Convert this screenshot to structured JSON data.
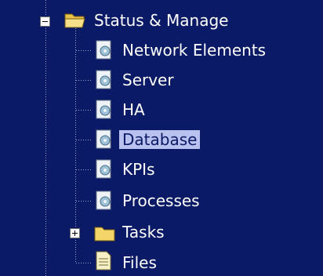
{
  "tree": {
    "root": {
      "label": "Status & Manage",
      "expanded": true,
      "children": [
        {
          "label": "Network Elements",
          "icon": "page-gear-icon"
        },
        {
          "label": "Server",
          "icon": "page-gear-icon"
        },
        {
          "label": "HA",
          "icon": "page-gear-icon"
        },
        {
          "label": "Database",
          "icon": "page-gear-icon",
          "selected": true
        },
        {
          "label": "KPIs",
          "icon": "page-gear-icon"
        },
        {
          "label": "Processes",
          "icon": "page-gear-icon"
        }
      ]
    },
    "tasks": {
      "label": "Tasks",
      "expanded": false
    },
    "files": {
      "label": "Files",
      "icon": "file-icon"
    }
  },
  "colors": {
    "background": "#0b1a66",
    "text": "#ffffff",
    "selection": "#b9c2ee"
  }
}
